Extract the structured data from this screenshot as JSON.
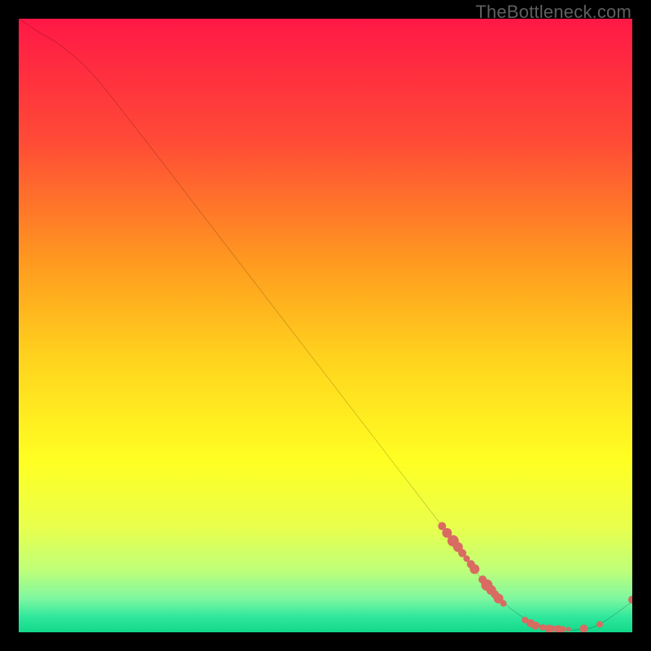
{
  "watermark": "TheBottleneck.com",
  "chart_data": {
    "type": "line",
    "title": "",
    "xlabel": "",
    "ylabel": "",
    "xlim": [
      0,
      100
    ],
    "ylim": [
      0,
      100
    ],
    "grid": false,
    "legend": false,
    "series": [
      {
        "name": "bottleneck-curve",
        "color": "#000000",
        "x": [
          0,
          3,
          7,
          12,
          20,
          30,
          40,
          50,
          60,
          70,
          76,
          80,
          84,
          88,
          92,
          95,
          100
        ],
        "y": [
          100,
          98,
          95.5,
          91,
          81,
          68,
          55,
          42,
          29,
          16,
          8,
          4,
          1.5,
          0.5,
          0.5,
          1.5,
          5
        ]
      }
    ],
    "scatter_points": {
      "name": "highlighted-values",
      "color": "#d86b62",
      "radius_range": [
        3,
        7
      ],
      "points": [
        {
          "x": 69.0,
          "y": 17.3,
          "r": 5
        },
        {
          "x": 69.8,
          "y": 16.2,
          "r": 6
        },
        {
          "x": 70.8,
          "y": 14.9,
          "r": 7
        },
        {
          "x": 71.6,
          "y": 13.9,
          "r": 6
        },
        {
          "x": 72.3,
          "y": 12.9,
          "r": 5
        },
        {
          "x": 73.0,
          "y": 12.0,
          "r": 4
        },
        {
          "x": 73.7,
          "y": 11.1,
          "r": 5
        },
        {
          "x": 74.3,
          "y": 10.3,
          "r": 6
        },
        {
          "x": 75.6,
          "y": 8.6,
          "r": 5
        },
        {
          "x": 76.3,
          "y": 7.7,
          "r": 7
        },
        {
          "x": 77.0,
          "y": 6.9,
          "r": 6
        },
        {
          "x": 77.6,
          "y": 6.2,
          "r": 5
        },
        {
          "x": 78.2,
          "y": 5.5,
          "r": 6
        },
        {
          "x": 79.0,
          "y": 4.7,
          "r": 4
        },
        {
          "x": 82.5,
          "y": 2.0,
          "r": 4
        },
        {
          "x": 83.4,
          "y": 1.5,
          "r": 5
        },
        {
          "x": 84.2,
          "y": 1.1,
          "r": 5
        },
        {
          "x": 85.4,
          "y": 0.8,
          "r": 4
        },
        {
          "x": 86.4,
          "y": 0.6,
          "r": 5
        },
        {
          "x": 87.0,
          "y": 0.6,
          "r": 4
        },
        {
          "x": 87.9,
          "y": 0.5,
          "r": 5
        },
        {
          "x": 88.6,
          "y": 0.5,
          "r": 4
        },
        {
          "x": 89.6,
          "y": 0.5,
          "r": 3
        },
        {
          "x": 92.1,
          "y": 0.6,
          "r": 5
        },
        {
          "x": 94.7,
          "y": 1.3,
          "r": 4
        },
        {
          "x": 100.0,
          "y": 5.3,
          "r": 5
        }
      ]
    },
    "background_gradient": {
      "direction": "vertical",
      "stops": [
        {
          "pos": 0.0,
          "color": "#ff1846"
        },
        {
          "pos": 0.2,
          "color": "#ff4b36"
        },
        {
          "pos": 0.4,
          "color": "#ff9b1f"
        },
        {
          "pos": 0.55,
          "color": "#ffd21e"
        },
        {
          "pos": 0.72,
          "color": "#ffff22"
        },
        {
          "pos": 0.83,
          "color": "#e8ff4d"
        },
        {
          "pos": 0.9,
          "color": "#beff7a"
        },
        {
          "pos": 0.945,
          "color": "#7ef7a0"
        },
        {
          "pos": 0.975,
          "color": "#2fe79c"
        },
        {
          "pos": 1.0,
          "color": "#12d88a"
        }
      ]
    }
  }
}
